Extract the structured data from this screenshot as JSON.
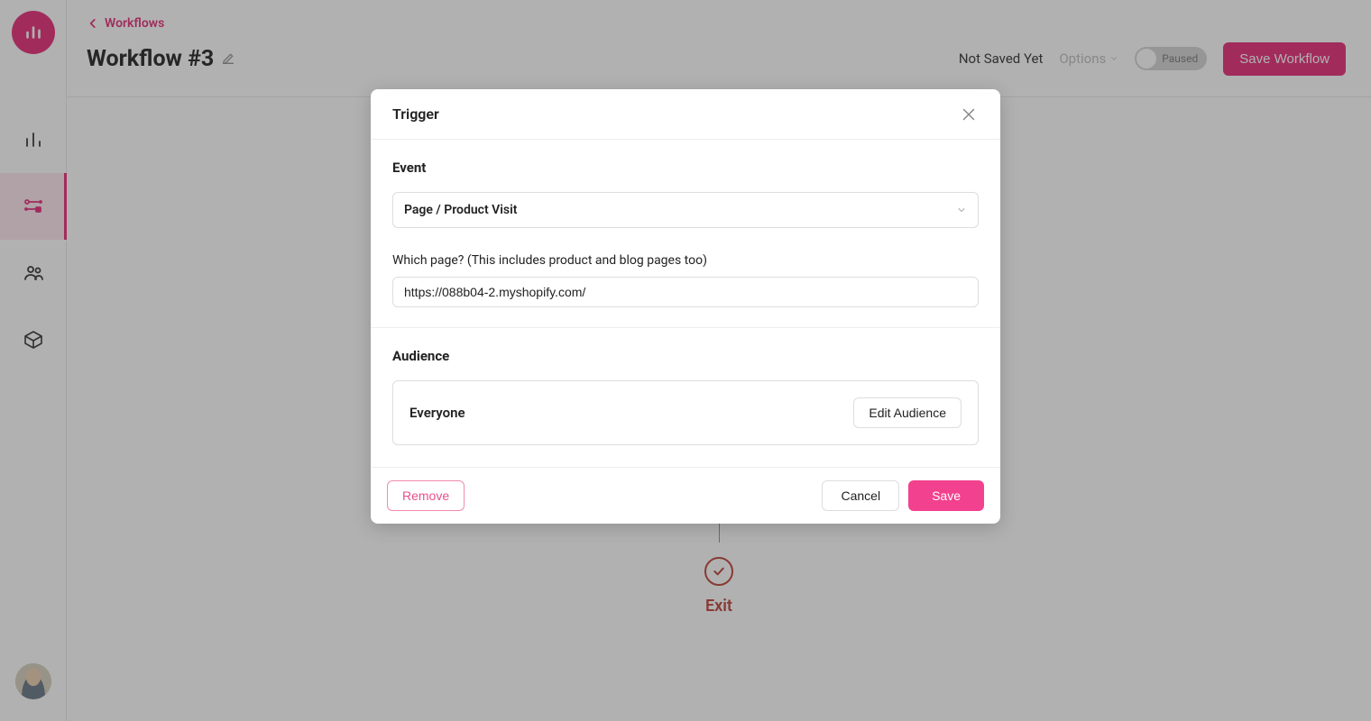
{
  "breadcrumb": {
    "label": "Workflows"
  },
  "title": "Workflow #3",
  "status": "Not Saved Yet",
  "options_label": "Options",
  "toggle_label": "Paused",
  "save_workflow_label": "Save Workflow",
  "sidebar": {
    "items": [
      {
        "name": "analytics"
      },
      {
        "name": "workflows"
      },
      {
        "name": "audience"
      },
      {
        "name": "packages"
      }
    ]
  },
  "exit_label": "Exit",
  "modal": {
    "title": "Trigger",
    "event_label": "Event",
    "event_value": "Page / Product Visit",
    "page_label": "Which page? (This includes product and blog pages too)",
    "page_value": "https://088b04-2.myshopify.com/",
    "audience_label": "Audience",
    "audience_value": "Everyone",
    "edit_audience_label": "Edit Audience",
    "remove_label": "Remove",
    "cancel_label": "Cancel",
    "save_label": "Save"
  },
  "colors": {
    "accent": "#e31b6d",
    "pink": "#f2418e",
    "red": "#b83229"
  }
}
